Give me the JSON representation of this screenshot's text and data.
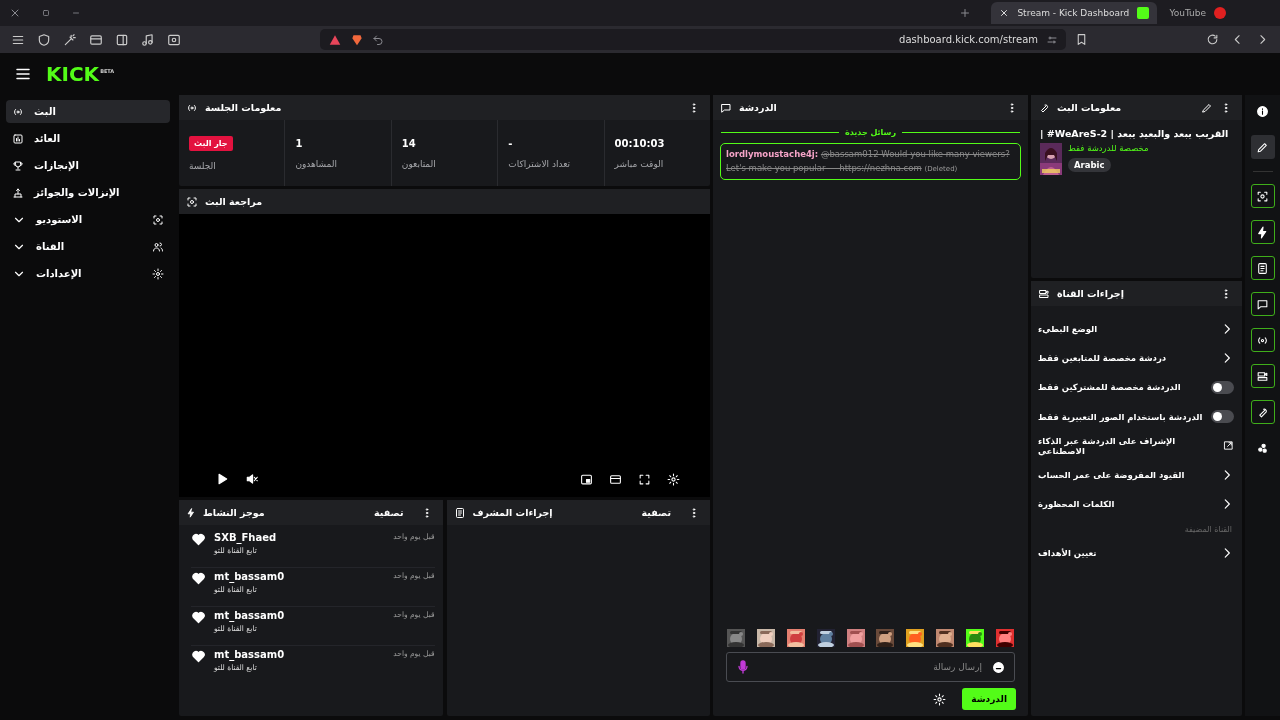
{
  "browser": {
    "tabs": [
      {
        "title": "YouTube",
        "selected": false
      },
      {
        "title": "Stream - Kick Dashboard",
        "selected": true
      }
    ],
    "address": "dashboard.kick.com/stream"
  },
  "header": {
    "logo": "KICK",
    "logo_badge": "BETA"
  },
  "sidebar": {
    "items": [
      {
        "label": "البث",
        "kind": "link",
        "selected": true
      },
      {
        "label": "العائد",
        "kind": "link",
        "selected": false
      },
      {
        "label": "الإنجازات",
        "kind": "link",
        "selected": false
      },
      {
        "label": "الإنزالات والجوائز",
        "kind": "link",
        "selected": false
      },
      {
        "label": "الاستوديو",
        "kind": "group",
        "selected": false,
        "expanded": false
      },
      {
        "label": "القناة",
        "kind": "group",
        "selected": false,
        "expanded": false
      },
      {
        "label": "الإعدادات",
        "kind": "group",
        "selected": false,
        "expanded": false
      }
    ]
  },
  "session": {
    "title": "معلومات الجلسة",
    "stats": [
      {
        "kind": "number",
        "value": "00:10:03",
        "label": "الوقت مباشر"
      },
      {
        "kind": "number",
        "value": "-",
        "label": "تعداد الاشتراكات"
      },
      {
        "kind": "number",
        "value": "14",
        "label": "المتابعون"
      },
      {
        "kind": "number",
        "value": "1",
        "label": "المشاهدون"
      },
      {
        "kind": "badge",
        "value": "جار البث",
        "label": "الجلسة"
      }
    ]
  },
  "preview": {
    "title": "مراجعة البث"
  },
  "activity": {
    "title": "موجز النشاط",
    "filter": "تصفية",
    "events": [
      {
        "user": "SXB_Fhaed",
        "action": "تابع القناة للتو",
        "time": "قبل يوم واحد"
      },
      {
        "user": "mt_bassam0",
        "action": "تابع القناة للتو",
        "time": "قبل يوم واحد"
      },
      {
        "user": "mt_bassam0",
        "action": "تابع القناة للتو",
        "time": "قبل يوم واحد"
      },
      {
        "user": "mt_bassam0",
        "action": "تابع القناة للتو",
        "time": "قبل يوم واحد"
      }
    ]
  },
  "mod_actions": {
    "title": "إجراءات المشرف",
    "filter": "تصفية"
  },
  "chat": {
    "title": "الدردشة",
    "divider": "رسائل جديدة",
    "messages": [
      {
        "user": "lordlymoustache4j:",
        "text": "@bassam012 Would you like many viewers? Let's make you popular — https://nezhna.com",
        "deleted": true,
        "note": "(Deleted)"
      }
    ],
    "input": {
      "placeholder": "إرسال رسالة"
    },
    "send": "الدردشة"
  },
  "stream_info": {
    "title": "معلومات البث",
    "stream_title": "| #WeAreS-2 | القريب يبعد والبعيد يبعد",
    "category": "مخصصة للدردشة فقط",
    "tags": [
      "Arabic"
    ]
  },
  "channel_actions": {
    "title": "إجراءات القناة",
    "items": [
      {
        "kind": "link",
        "label": "الوضع البطيء"
      },
      {
        "kind": "link",
        "label": "دردشة مخصصة للمتابعين فقط"
      },
      {
        "kind": "toggle",
        "label": "الدردشة مخصصة للمشتركين فقط",
        "on": false
      },
      {
        "kind": "toggle",
        "label": "الدردشة باستخدام الصور التعبيرية فقط",
        "on": false
      },
      {
        "kind": "external",
        "label": "الإشراف على الدردشة عبر الذكاء الاصطناعي"
      },
      {
        "kind": "link",
        "label": "القيود المفروضة على عمر الحساب"
      },
      {
        "kind": "link",
        "label": "الكلمات المحظورة"
      },
      {
        "kind": "section",
        "label": "القناة المضيفة"
      },
      {
        "kind": "link",
        "label": "تعيين الأهداف"
      }
    ]
  },
  "rail": {
    "items": [
      {
        "selected": false,
        "pinned": false
      },
      {
        "selected": true,
        "pinned": false
      },
      {
        "selected": false,
        "pinned": true
      },
      {
        "selected": false,
        "pinned": true
      },
      {
        "selected": false,
        "pinned": true
      },
      {
        "selected": false,
        "pinned": true
      },
      {
        "selected": false,
        "pinned": true
      },
      {
        "selected": false,
        "pinned": true
      },
      {
        "selected": false,
        "pinned": true
      },
      {
        "selected": false,
        "pinned": false
      }
    ]
  }
}
